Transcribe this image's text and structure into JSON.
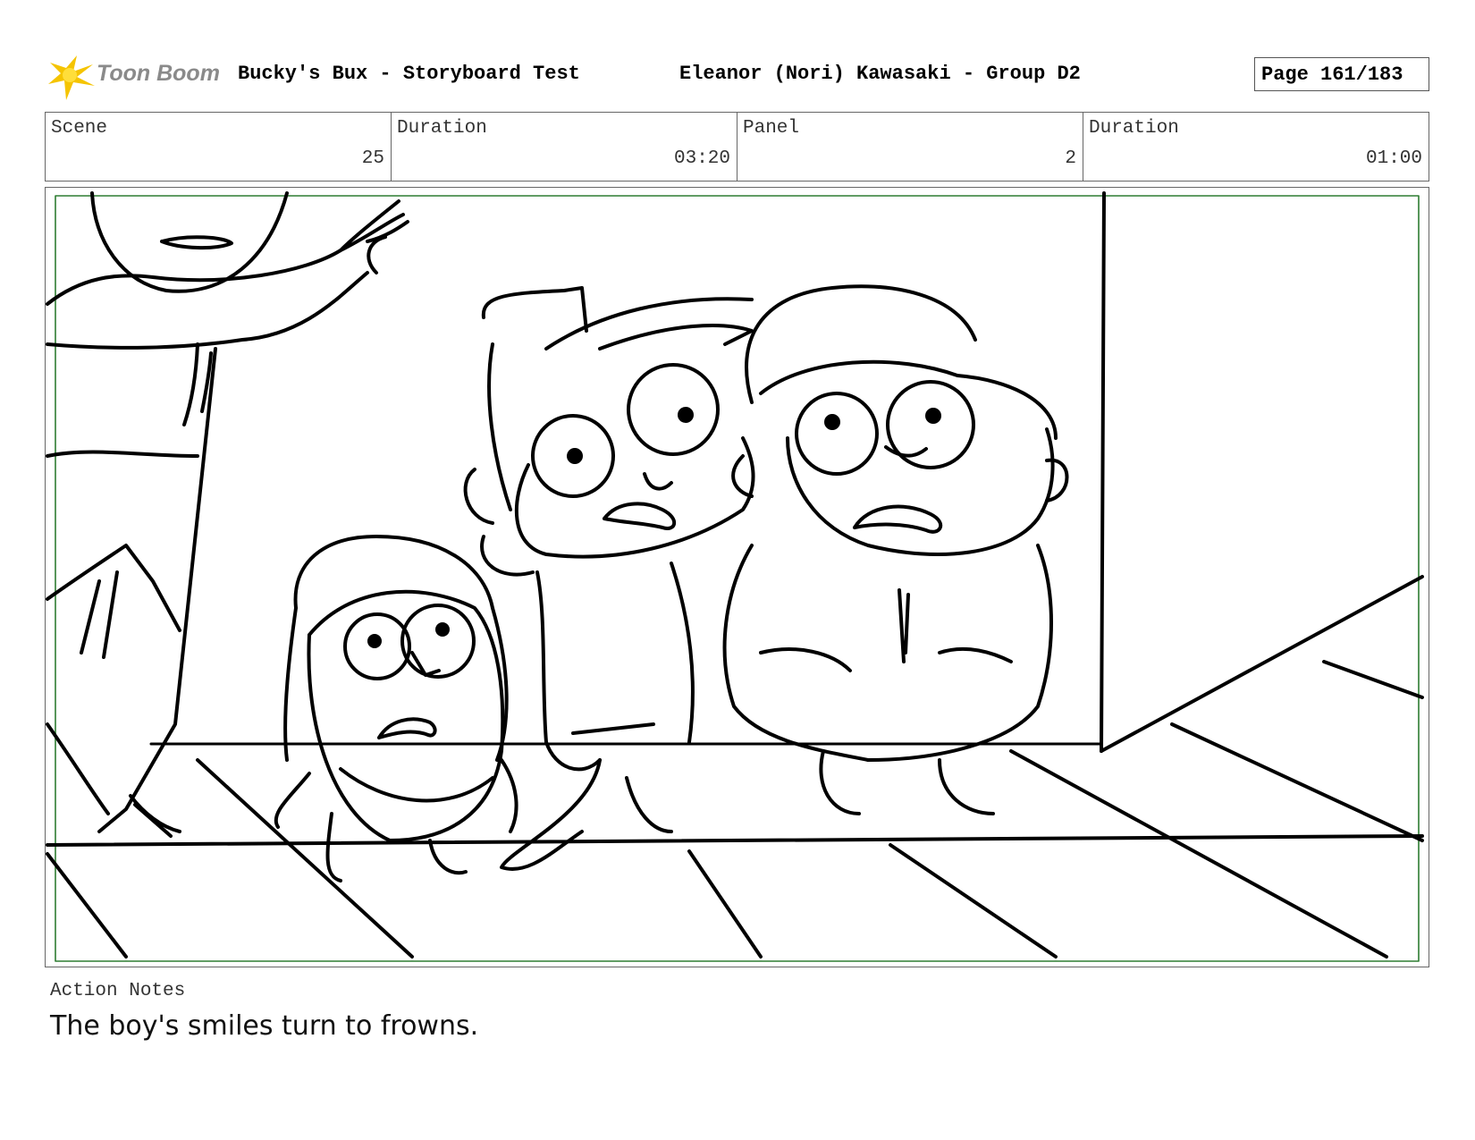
{
  "header": {
    "logo_text": "Toon Boom",
    "title": "Bucky's Bux - Storyboard Test",
    "artist": "Eleanor (Nori) Kawasaki - Group D2",
    "page": "Page 161/183"
  },
  "info": {
    "scene_label": "Scene",
    "scene_value": "25",
    "scene_duration_label": "Duration",
    "scene_duration_value": "03:20",
    "panel_label": "Panel",
    "panel_value": "2",
    "panel_duration_label": "Duration",
    "panel_duration_value": "01:00"
  },
  "notes": {
    "label": "Action Notes",
    "text": "The boy's smiles turn to frowns."
  },
  "colors": {
    "safe_area": "#2e7d32",
    "logo_star": "#f5c400"
  }
}
